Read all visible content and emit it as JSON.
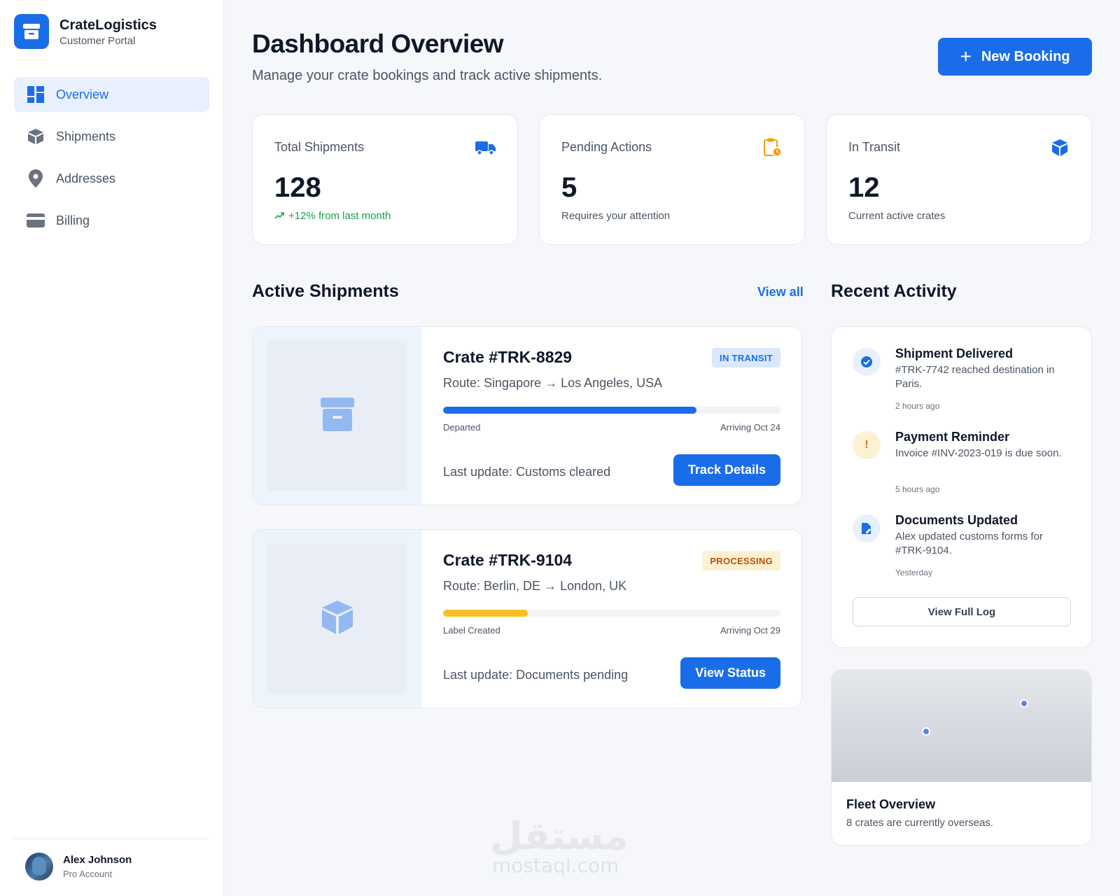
{
  "brand": {
    "name": "CrateLogistics",
    "subtitle": "Customer Portal"
  },
  "sidebar": {
    "items": [
      {
        "label": "Overview",
        "icon": "dashboard-icon",
        "active": true
      },
      {
        "label": "Shipments",
        "icon": "package-icon",
        "active": false
      },
      {
        "label": "Addresses",
        "icon": "map-pin-icon",
        "active": false
      },
      {
        "label": "Billing",
        "icon": "credit-card-icon",
        "active": false
      }
    ]
  },
  "user": {
    "name": "Alex Johnson",
    "role": "Pro Account"
  },
  "header": {
    "title": "Dashboard Overview",
    "subtitle": "Manage your crate bookings and track active shipments.",
    "new_booking_label": "New Booking"
  },
  "stats": [
    {
      "label": "Total Shipments",
      "value": "128",
      "note": "+12% from last month",
      "icon": "truck-icon",
      "icon_color": "#1a6de8"
    },
    {
      "label": "Pending Actions",
      "value": "5",
      "note": "Requires your attention",
      "icon": "clipboard-clock-icon",
      "icon_color": "#f59e0b"
    },
    {
      "label": "In Transit",
      "value": "12",
      "note": "Current active crates",
      "icon": "cube-icon",
      "icon_color": "#1a6de8"
    }
  ],
  "active_shipments": {
    "title": "Active Shipments",
    "view_all_label": "View all",
    "items": [
      {
        "title": "Crate #TRK-8829",
        "status": "IN TRANSIT",
        "route": "Route: Singapore → Los Angeles, USA",
        "progress": 0.75,
        "progress_color": "#1a6de8",
        "from_label": "Departed",
        "to_label": "Arriving Oct 24",
        "last_update": "Last update: Customs cleared",
        "action_label": "Track Details",
        "thumb_icon": "archive-box-icon"
      },
      {
        "title": "Crate #TRK-9104",
        "status": "PROCESSING",
        "route": "Route: Berlin, DE → London, UK",
        "progress": 0.25,
        "progress_color": "#fbbf24",
        "from_label": "Label Created",
        "to_label": "Arriving Oct 29",
        "last_update": "Last update: Documents pending",
        "action_label": "View Status",
        "thumb_icon": "cube-icon"
      }
    ]
  },
  "recent_activity": {
    "title": "Recent Activity",
    "items": [
      {
        "title": "Shipment Delivered",
        "desc": "#TRK-7742 reached destination in Paris.",
        "time": "2 hours ago",
        "icon": "check-circle-icon"
      },
      {
        "title": "Payment Reminder",
        "desc": "Invoice #INV-2023-019 is due soon.",
        "time": "5 hours ago",
        "icon": "alert-icon"
      },
      {
        "title": "Documents Updated",
        "desc": "Alex updated customs forms for #TRK-9104.",
        "time": "Yesterday",
        "icon": "document-edit-icon"
      }
    ],
    "view_log_label": "View Full Log"
  },
  "fleet": {
    "title": "Fleet Overview",
    "subtitle": "8 crates are currently overseas."
  },
  "watermark": {
    "arabic": "مستقل",
    "latin": "mostaql.com"
  }
}
